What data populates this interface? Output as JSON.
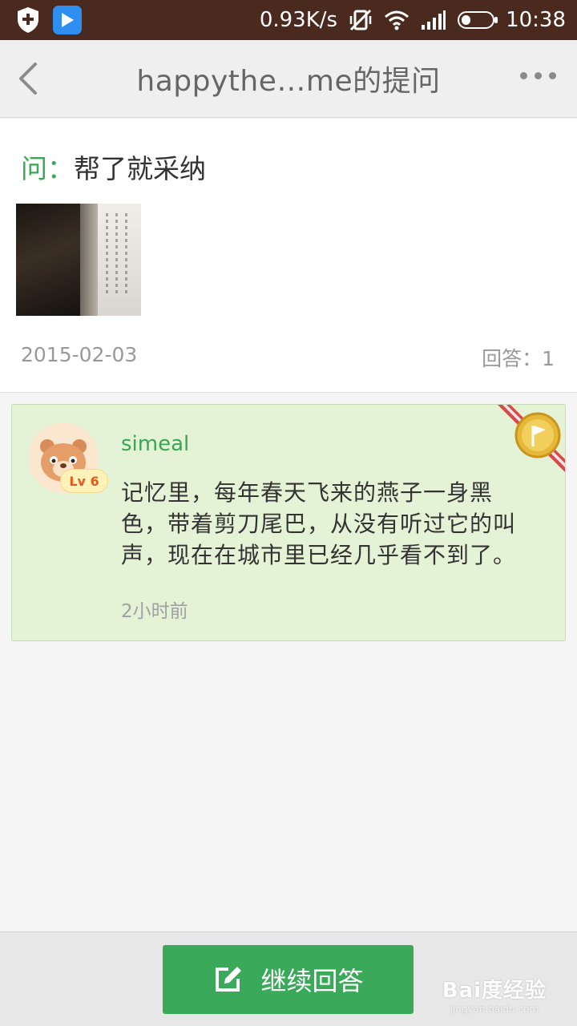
{
  "status_bar": {
    "net_speed": "0.93K/s",
    "time": "10:38",
    "battery_level": 0.3
  },
  "nav": {
    "title": "happythe…me的提问"
  },
  "question": {
    "prefix": "问：",
    "text": "帮了就采纳",
    "date": "2015-02-03",
    "answers_label": "回答：1"
  },
  "answer": {
    "username": "simeal",
    "level": "Lv 6",
    "text": "记忆里，每年春天飞来的燕子一身黑色，带着剪刀尾巴，从没有听过它的叫声，现在在城市里已经几乎看不到了。",
    "time": "2小时前"
  },
  "bottom": {
    "continue_label": "继续回答"
  },
  "watermark": {
    "logo": "Bai度经验",
    "url": "jingyan.baidu.com"
  },
  "colors": {
    "accent_green": "#3aa655",
    "status_bar_bg": "#4a2a1e",
    "answer_card_bg": "#e4f3d6",
    "level_badge_text": "#e55a1f"
  }
}
